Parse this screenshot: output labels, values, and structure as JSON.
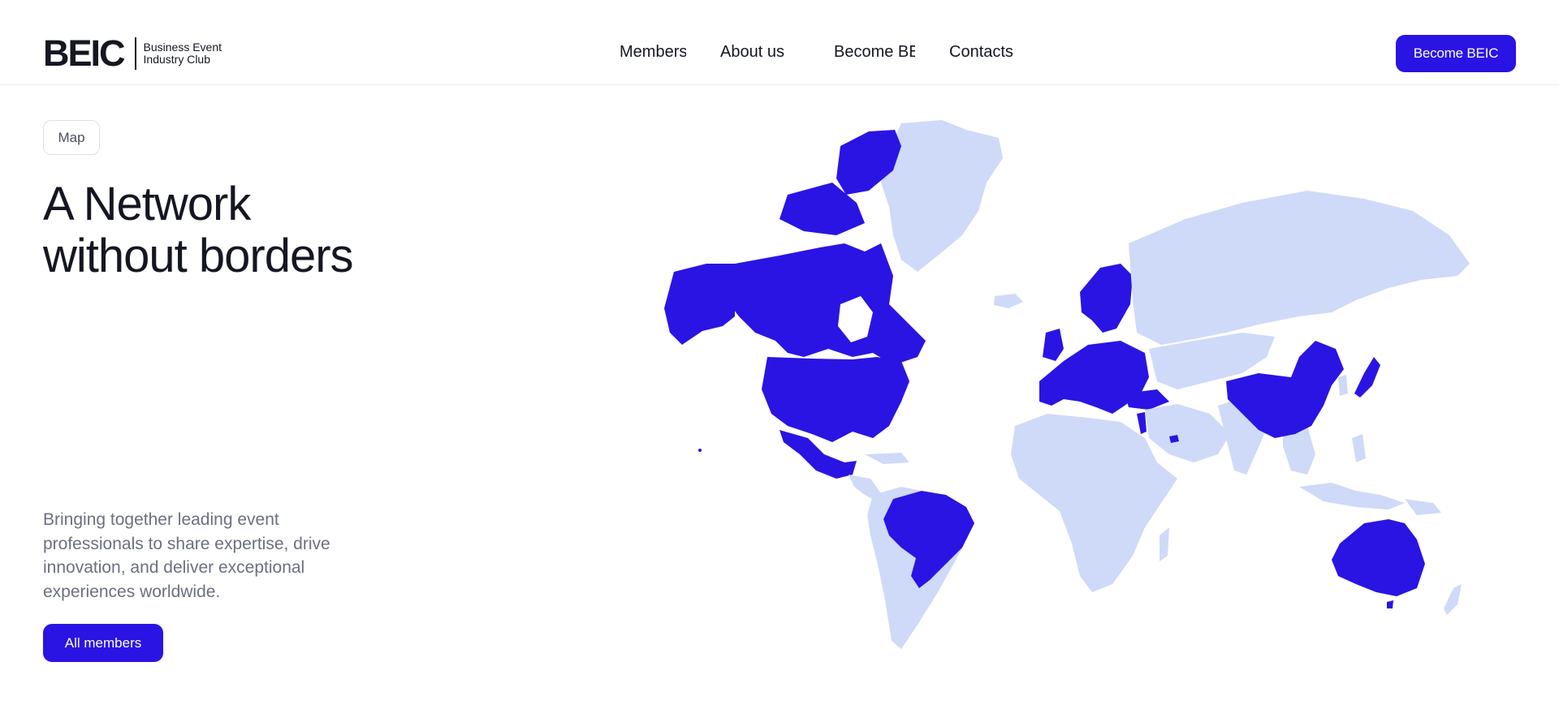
{
  "header": {
    "logo_mark": "BEIC",
    "logo_sub_line1": "Business Event",
    "logo_sub_line2": "Industry Club",
    "nav": [
      "Members",
      "About us",
      "Become BE",
      "Contacts"
    ],
    "cta_label": "Become BEIC"
  },
  "hero": {
    "tag": "Map",
    "title_line1": "A Network",
    "title_line2": "without borders",
    "description": "Bringing together leading event professionals to share expertise, drive innovation, and deliver exceptional experiences worldwide.",
    "button_label": "All members"
  },
  "map": {
    "highlighted_regions": [
      "Canada",
      "United States",
      "Mexico",
      "Brazil",
      "Europe",
      "Israel",
      "United Arab Emirates",
      "China",
      "Japan",
      "Australia"
    ],
    "colors": {
      "highlight": "#2a14e3",
      "base": "#cfdaf8"
    }
  }
}
